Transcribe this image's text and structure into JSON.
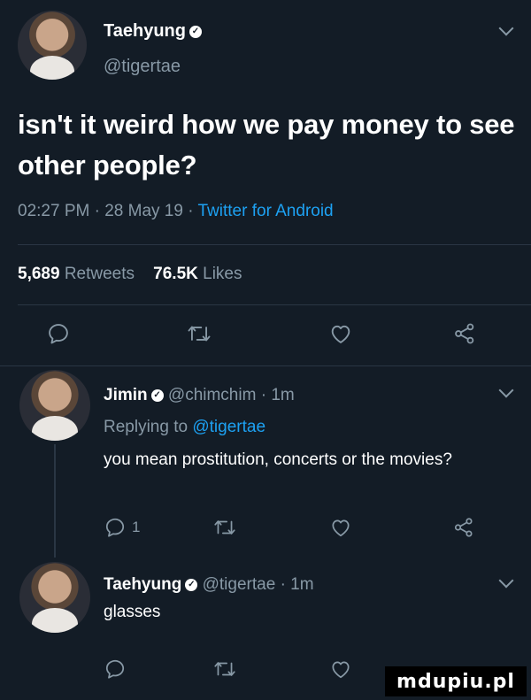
{
  "main_tweet": {
    "author_name": "Taehyung",
    "handle": "@tigertae",
    "text": "isn't it weird how we pay money to see other people?",
    "time": "02:27 PM",
    "date": "28 May 19",
    "source": "Twitter for Android",
    "retweets_count": "5,689",
    "retweets_label": "Retweets",
    "likes_count": "76.5K",
    "likes_label": "Likes"
  },
  "replies": [
    {
      "author_name": "Jimin",
      "handle": "@chimchim",
      "time": "1m",
      "replying_to_label": "Replying to",
      "replying_to_handle": "@tigertae",
      "text": "you mean prostitution, concerts or the movies?",
      "reply_count": "1"
    },
    {
      "author_name": "Taehyung",
      "handle": "@tigertae",
      "time": "1m",
      "text": "glasses"
    }
  ],
  "separator": "·",
  "icons": {
    "reply": "reply-icon",
    "retweet": "retweet-icon",
    "like": "heart-icon",
    "share": "share-icon",
    "more": "chevron-down-icon",
    "verified": "verified-badge-icon"
  },
  "colors": {
    "background": "#131c26",
    "muted": "#8899a6",
    "link": "#1da1f2",
    "divider": "#2a3644"
  },
  "watermark": "mdupiu.pl"
}
